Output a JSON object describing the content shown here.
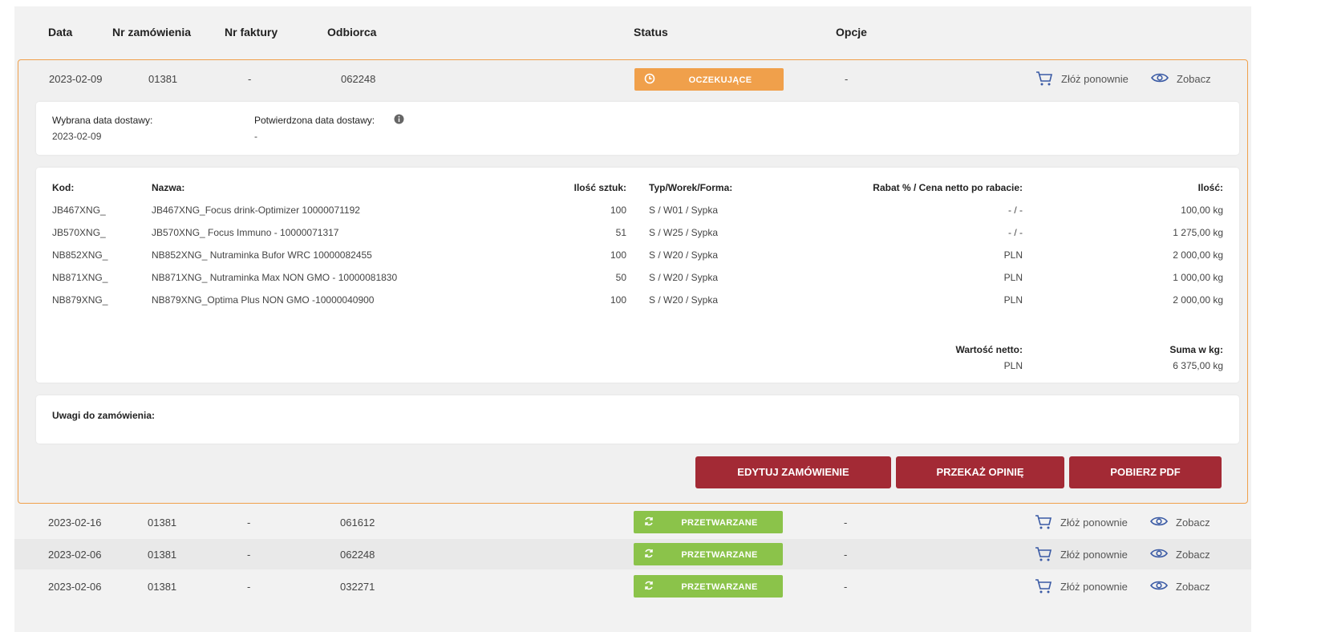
{
  "columns": [
    "Data",
    "Nr zamówienia",
    "Nr faktury",
    "Odbiorca",
    "Status",
    "Opcje"
  ],
  "expanded_order": {
    "date": "2023-02-09",
    "order_no": "01381",
    "invoice_no": "-",
    "recipient": "062248",
    "status": "OCZEKUJĄCE",
    "options_value": "-",
    "reorder_label": "Złóż ponownie",
    "view_label": "Zobacz",
    "delivery": {
      "selected_label": "Wybrana data dostawy:",
      "selected_value": "2023-02-09",
      "confirmed_label": "Potwierdzona data dostawy:",
      "confirmed_value": "-"
    },
    "items_header": {
      "code": "Kod:",
      "name": "Nazwa:",
      "qty": "Ilość sztuk:",
      "type": "Typ/Worek/Forma:",
      "discount": "Rabat % / Cena netto po rabacie:",
      "amount": "Ilość:"
    },
    "items": [
      {
        "code": "JB467XNG_",
        "name": "JB467XNG_Focus drink-Optimizer 10000071192",
        "qty": "100",
        "type": "S / W01 / Sypka",
        "discount": "- / -",
        "amount": "100,00 kg"
      },
      {
        "code": "JB570XNG_",
        "name": "JB570XNG_ Focus Immuno - 10000071317",
        "qty": "51",
        "type": "S / W25 / Sypka",
        "discount": "- / -",
        "amount": "1 275,00 kg"
      },
      {
        "code": "NB852XNG_",
        "name": "NB852XNG_ Nutraminka Bufor WRC 10000082455",
        "qty": "100",
        "type": "S / W20 / Sypka",
        "discount": "PLN",
        "amount": "2 000,00 kg"
      },
      {
        "code": "NB871XNG_",
        "name": "NB871XNG_ Nutraminka Max NON GMO - 10000081830",
        "qty": "50",
        "type": "S / W20 / Sypka",
        "discount": "PLN",
        "amount": "1 000,00 kg"
      },
      {
        "code": "NB879XNG_",
        "name": "NB879XNG_Optima Plus NON GMO -10000040900",
        "qty": "100",
        "type": "S / W20 / Sypka",
        "discount": "PLN",
        "amount": "2 000,00 kg"
      }
    ],
    "totals": {
      "net_label": "Wartość netto:",
      "net_value": "PLN",
      "sum_label": "Suma w kg:",
      "sum_value": "6 375,00 kg"
    },
    "notes_label": "Uwagi do zamówienia:",
    "buttons": {
      "edit": "EDYTUJ ZAMÓWIENIE",
      "feedback": "PRZEKAŻ OPINIĘ",
      "pdf": "POBIERZ PDF"
    }
  },
  "other_orders": [
    {
      "date": "2023-02-16",
      "order_no": "01381",
      "invoice_no": "-",
      "recipient": "061612",
      "status": "PRZETWARZANE",
      "options_value": "-",
      "reorder_label": "Złóż ponownie",
      "view_label": "Zobacz"
    },
    {
      "date": "2023-02-06",
      "order_no": "01381",
      "invoice_no": "-",
      "recipient": "062248",
      "status": "PRZETWARZANE",
      "options_value": "-",
      "reorder_label": "Złóż ponownie",
      "view_label": "Zobacz"
    },
    {
      "date": "2023-02-06",
      "order_no": "01381",
      "invoice_no": "-",
      "recipient": "032271",
      "status": "PRZETWARZANE",
      "options_value": "-",
      "reorder_label": "Złóż ponownie",
      "view_label": "Zobacz"
    }
  ],
  "colors": {
    "waiting": "#f0a04b",
    "processing": "#8bc34a",
    "primary_button": "#a32a35",
    "icon_blue": "#3b5ba5"
  },
  "icons": {
    "status_waiting": "clock-icon",
    "status_processing": "refresh-icon",
    "reorder": "cart-icon",
    "view": "eye-icon",
    "info": "info-icon"
  }
}
